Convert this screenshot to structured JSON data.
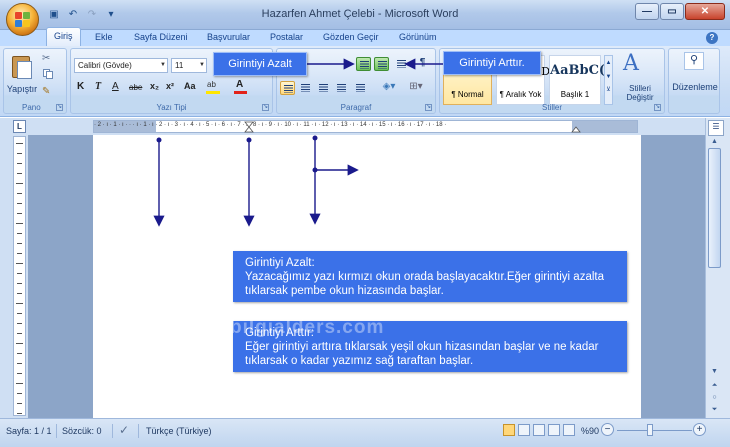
{
  "window": {
    "title": "Hazarfen Ahmet Çelebi - Microsoft Word"
  },
  "tabs": [
    "Giriş",
    "Ekle",
    "Sayfa Düzeni",
    "Başvurular",
    "Postalar",
    "Gözden Geçir",
    "Görünüm"
  ],
  "ribbon": {
    "clipboard": {
      "group_label": "Pano",
      "paste_label": "Yapıştır"
    },
    "font": {
      "group_label": "Yazı Tipi",
      "font_name": "Calibri (Gövde)",
      "font_size": "11",
      "bold": "K",
      "italic": "T",
      "underline": "A",
      "strike": "abe",
      "subscript": "x₂",
      "superscript": "x²",
      "change_case": "Aa",
      "font_color": "A"
    },
    "paragraph": {
      "group_label": "Paragraf"
    },
    "styles": {
      "group_label": "Stiller",
      "change_styles": "Stilleri Değiştir",
      "items": [
        {
          "sample": "AaBbCcDc",
          "name": "¶ Normal"
        },
        {
          "sample": "AaBbCcDc",
          "name": "¶ Aralık Yok"
        },
        {
          "sample": "AaBbC(",
          "name": "Başlık 1"
        }
      ]
    },
    "editing": {
      "label": "Düzenleme"
    }
  },
  "ruler": {
    "numbers": "· 2 · ı · 1 · ı · · · ı · 1 · ı · 2 · ı · 3 · ı · 4 · ı · 5 · ı · 6 · ı · 7 · ı · 8 · ı · 9 · ı · 10 · ı · 11 · ı · 12 · ı · 13 · ı · 14 · ı · 15 · ı · 16 · ı · 17 · ı · 18 ·"
  },
  "callouts": {
    "decrease": "Girintiyi Azalt",
    "increase": "Girintiyi Arttır."
  },
  "notes": [
    {
      "title": "Girintiyi Azalt:",
      "body": "Yazacağımız yazı kırmızı okun orada başlayacaktır.Eğer girintiyi azalta tıklarsak pembe okun hizasında başlar."
    },
    {
      "title": "Girintiyi Arttır:",
      "body": "Eğer girintiyi arttıra tıklarsak yeşil okun hizasından başlar ve ne kadar tıklarsak o kadar yazımız sağ taraftan başlar."
    }
  ],
  "watermark": "bilgialders.com",
  "status": {
    "page": "Sayfa: 1 / 1",
    "words": "Sözcük: 0",
    "language": "Türkçe (Türkiye)",
    "zoom": "%90"
  },
  "colors": {
    "callout_blue": "#3b71e8",
    "arrow_navy": "#1a1a8c",
    "ribbon_bg": "#c7dbf4"
  }
}
